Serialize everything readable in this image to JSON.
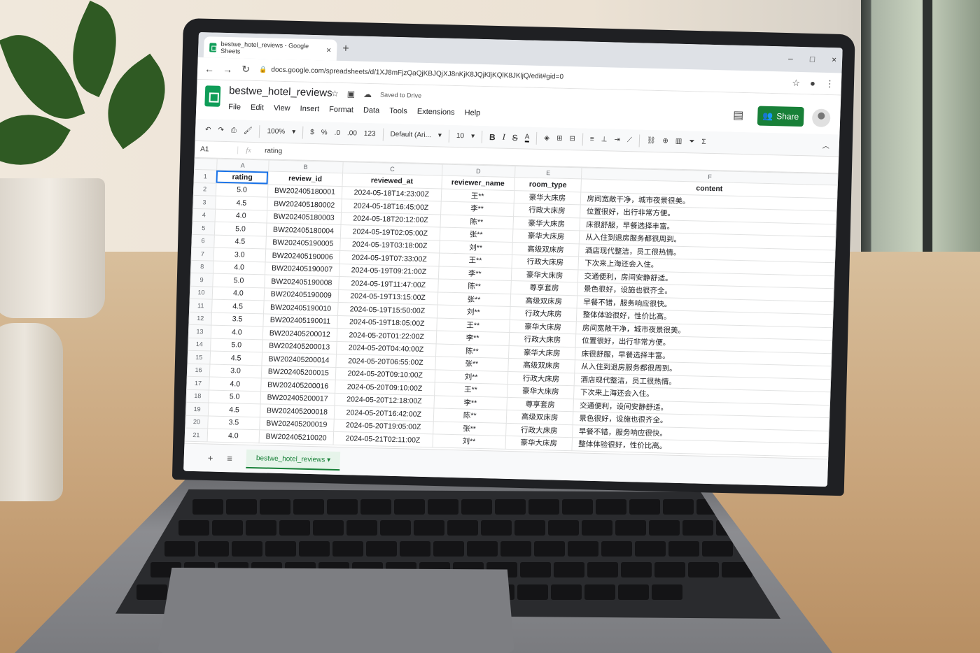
{
  "browser": {
    "tab_title": "bestwe_hotel_reviews - Google Sheets",
    "tab_close": "×",
    "new_tab": "+",
    "url": "docs.google.com/spreadsheets/d/1XJ8mFjzQaQjKBJQjXJ8nKjK8JQjKljKQlK8JKljQ/edit#gid=0",
    "window_controls": [
      "–",
      "□",
      "×"
    ]
  },
  "app": {
    "doc_title": "bestwe_hotel_reviews",
    "saved_status": "Saved to Drive",
    "menus": [
      "File",
      "Edit",
      "View",
      "Insert",
      "Format",
      "Data",
      "Tools",
      "Extensions",
      "Help"
    ],
    "share_label": "Share"
  },
  "toolbar": {
    "zoom": "100%",
    "currency": "$",
    "percent": "%",
    "dec_decrease": ".0",
    "dec_increase": ".00",
    "more_formats": "123",
    "font": "Default (Ari...",
    "font_size": "10",
    "bold": "B",
    "italic": "I",
    "strike": "S",
    "text_color": "A",
    "functions": "Σ"
  },
  "formula_bar": {
    "cell_ref": "A1",
    "fx": "fx",
    "value": "rating"
  },
  "grid": {
    "col_letters": [
      "A",
      "B",
      "C",
      "D",
      "E",
      "F"
    ],
    "headers": [
      "rating",
      "review_id",
      "reviewed_at",
      "reviewer_name",
      "room_type",
      "content"
    ],
    "rows": [
      [
        "5.0",
        "BW202405180001",
        "2024-05-18T14:23:00Z",
        "王**",
        "豪华大床房",
        "房间宽敞干净，城市夜景很美。"
      ],
      [
        "4.5",
        "BW202405180002",
        "2024-05-18T16:45:00Z",
        "李**",
        "行政大床房",
        "位置很好，出行非常方便。"
      ],
      [
        "4.0",
        "BW202405180003",
        "2024-05-18T20:12:00Z",
        "陈**",
        "豪华大床房",
        "床很舒服，早餐选择丰富。"
      ],
      [
        "5.0",
        "BW202405180004",
        "2024-05-19T02:05:00Z",
        "张**",
        "豪华大床房",
        "从入住到退房服务都很周到。"
      ],
      [
        "4.5",
        "BW202405190005",
        "2024-05-19T03:18:00Z",
        "刘**",
        "高级双床房",
        "酒店现代整洁，员工很热情。"
      ],
      [
        "3.0",
        "BW202405190006",
        "2024-05-19T07:33:00Z",
        "王**",
        "行政大床房",
        "下次来上海还会入住。"
      ],
      [
        "4.0",
        "BW202405190007",
        "2024-05-19T09:21:00Z",
        "李**",
        "豪华大床房",
        "交通便利，房间安静舒适。"
      ],
      [
        "5.0",
        "BW202405190008",
        "2024-05-19T11:47:00Z",
        "陈**",
        "尊享套房",
        "景色很好，设施也很齐全。"
      ],
      [
        "4.0",
        "BW202405190009",
        "2024-05-19T13:15:00Z",
        "张**",
        "高级双床房",
        "早餐不错，服务响应很快。"
      ],
      [
        "4.5",
        "BW202405190010",
        "2024-05-19T15:50:00Z",
        "刘**",
        "行政大床房",
        "整体体验很好，性价比高。"
      ],
      [
        "3.5",
        "BW202405190011",
        "2024-05-19T18:05:00Z",
        "王**",
        "豪华大床房",
        "房间宽敞干净，城市夜景很美。"
      ],
      [
        "4.0",
        "BW202405200012",
        "2024-05-20T01:22:00Z",
        "李**",
        "行政大床房",
        "位置很好，出行非常方便。"
      ],
      [
        "5.0",
        "BW202405200013",
        "2024-05-20T04:40:00Z",
        "陈**",
        "豪华大床房",
        "床很舒服，早餐选择丰富。"
      ],
      [
        "4.5",
        "BW202405200014",
        "2024-05-20T06:55:00Z",
        "张**",
        "高级双床房",
        "从入住到退房服务都很周到。"
      ],
      [
        "3.0",
        "BW202405200015",
        "2024-05-20T09:10:00Z",
        "刘**",
        "行政大床房",
        "酒店现代整洁，员工很热情。"
      ],
      [
        "4.0",
        "BW202405200016",
        "2024-05-20T09:10:00Z",
        "王**",
        "豪华大床房",
        "下次来上海还会入住。"
      ],
      [
        "5.0",
        "BW202405200017",
        "2024-05-20T12:18:00Z",
        "李**",
        "尊享套房",
        "交通便利，设间安静舒适。"
      ],
      [
        "4.5",
        "BW202405200018",
        "2024-05-20T16:42:00Z",
        "陈**",
        "高级双床房",
        "景色很好，设施也很齐全。"
      ],
      [
        "3.5",
        "BW202405200019",
        "2024-05-20T19:05:00Z",
        "张**",
        "行政大床房",
        "早餐不错，服务响应很快。"
      ],
      [
        "4.0",
        "BW202405210020",
        "2024-05-21T02:11:00Z",
        "刘**",
        "豪华大床房",
        "整体体验很好，性价比高。"
      ]
    ]
  },
  "sheet_tabs": {
    "add": "+",
    "list": "≡",
    "active": "bestwe_hotel_reviews"
  }
}
